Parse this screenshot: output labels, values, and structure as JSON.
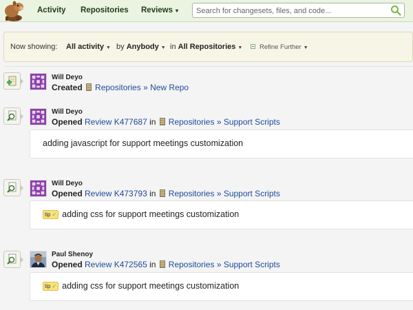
{
  "nav": {
    "items": [
      {
        "label": "Activity",
        "caret": ""
      },
      {
        "label": "Repositories",
        "caret": ""
      },
      {
        "label": "Reviews",
        "caret": "▾"
      }
    ],
    "search_placeholder": "Search for changesets, files, and code..."
  },
  "filters": {
    "prefix": "Now showing:",
    "activity": "All activity",
    "by_label": "by",
    "by_value": "Anybody",
    "in_label": "in",
    "in_value": "All Repositories",
    "refine": "Refine Further"
  },
  "feed": [
    {
      "author": "Will Deyo",
      "action": "Created",
      "review": "",
      "in": "",
      "repo_path": "Repositories » New Repo",
      "tip": "",
      "description": ""
    },
    {
      "author": "Will Deyo",
      "action": "Opened",
      "review": "Review K477687",
      "in": "in",
      "repo_path": "Repositories » Support Scripts",
      "tip": "",
      "description": "adding javascript for support meetings customization"
    },
    {
      "author": "Will Deyo",
      "action": "Opened",
      "review": "Review K473793",
      "in": "in",
      "repo_path": "Repositories » Support Scripts",
      "tip": "tip",
      "description": "adding css for support meetings customization"
    },
    {
      "author": "Paul Shenoy",
      "action": "Opened",
      "review": "Review K472565",
      "in": "in",
      "repo_path": "Repositories » Support Scripts",
      "tip": "tip",
      "description": "adding css for support meetings customization"
    }
  ]
}
